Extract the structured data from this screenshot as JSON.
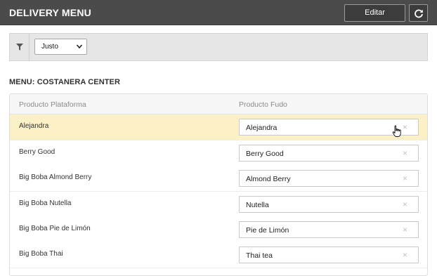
{
  "header": {
    "title": "DELIVERY MENU",
    "edit_label": "Editar"
  },
  "filter": {
    "selected": "Justo"
  },
  "menu": {
    "heading": "MENU: COSTANERA CENTER"
  },
  "table": {
    "columns": [
      "Producto Plataforma",
      "Producto Fudo"
    ],
    "rows": [
      {
        "platform": "Alejandra",
        "fudo": "Alejandra",
        "highlighted": true
      },
      {
        "platform": "Berry Good",
        "fudo": "Berry Good"
      },
      {
        "platform": "Big Boba Almond Berry",
        "fudo": "Almond Berry"
      },
      {
        "platform": "Big Boba Nutella",
        "fudo": "Nutella"
      },
      {
        "platform": "Big Boba Pie de Limón",
        "fudo": "Pie de Limón"
      },
      {
        "platform": "Big Boba Thai",
        "fudo": "Thai tea"
      }
    ],
    "clear_glyph": "×"
  },
  "colors": {
    "topbar": "#4b4b4b",
    "highlight_row": "#fcf1c6"
  }
}
